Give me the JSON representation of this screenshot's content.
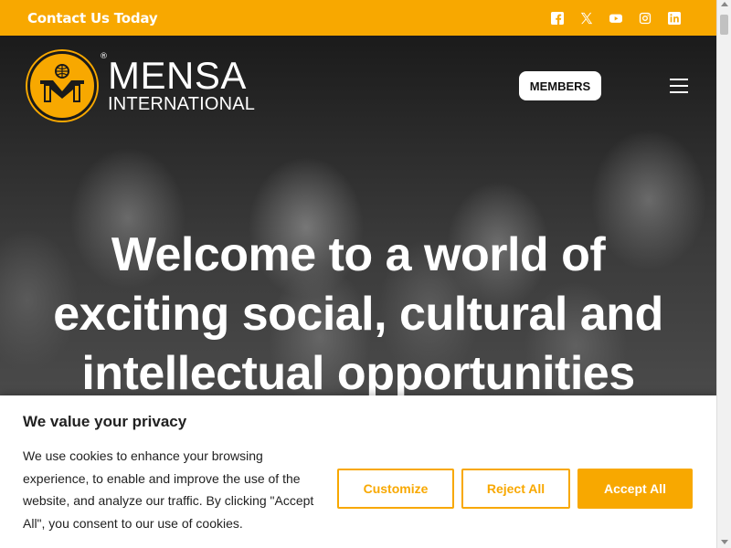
{
  "topbar": {
    "contact_label": "Contact Us Today",
    "social": [
      {
        "icon": "facebook-icon"
      },
      {
        "icon": "x-twitter-icon"
      },
      {
        "icon": "youtube-icon"
      },
      {
        "icon": "instagram-icon"
      },
      {
        "icon": "linkedin-icon"
      }
    ]
  },
  "header": {
    "logo_line1": "MENSA",
    "logo_line2": "INTERNATIONAL",
    "logo_reg": "®",
    "members_label": "MEMBERS"
  },
  "hero": {
    "headline_lines": [
      "Welcome to a world of",
      "exciting social, cultural and",
      "intellectual opportunities"
    ]
  },
  "cookie": {
    "title": "We value your privacy",
    "body": "We use cookies to enhance your browsing experience, to enable and improve the use of the website, and analyze our traffic. By clicking \"Accept All\", you consent to our use of cookies.",
    "customize_label": "Customize",
    "reject_label": "Reject All",
    "accept_label": "Accept All"
  },
  "colors": {
    "accent": "#f8a800",
    "text_dark": "#212121",
    "white": "#ffffff"
  }
}
